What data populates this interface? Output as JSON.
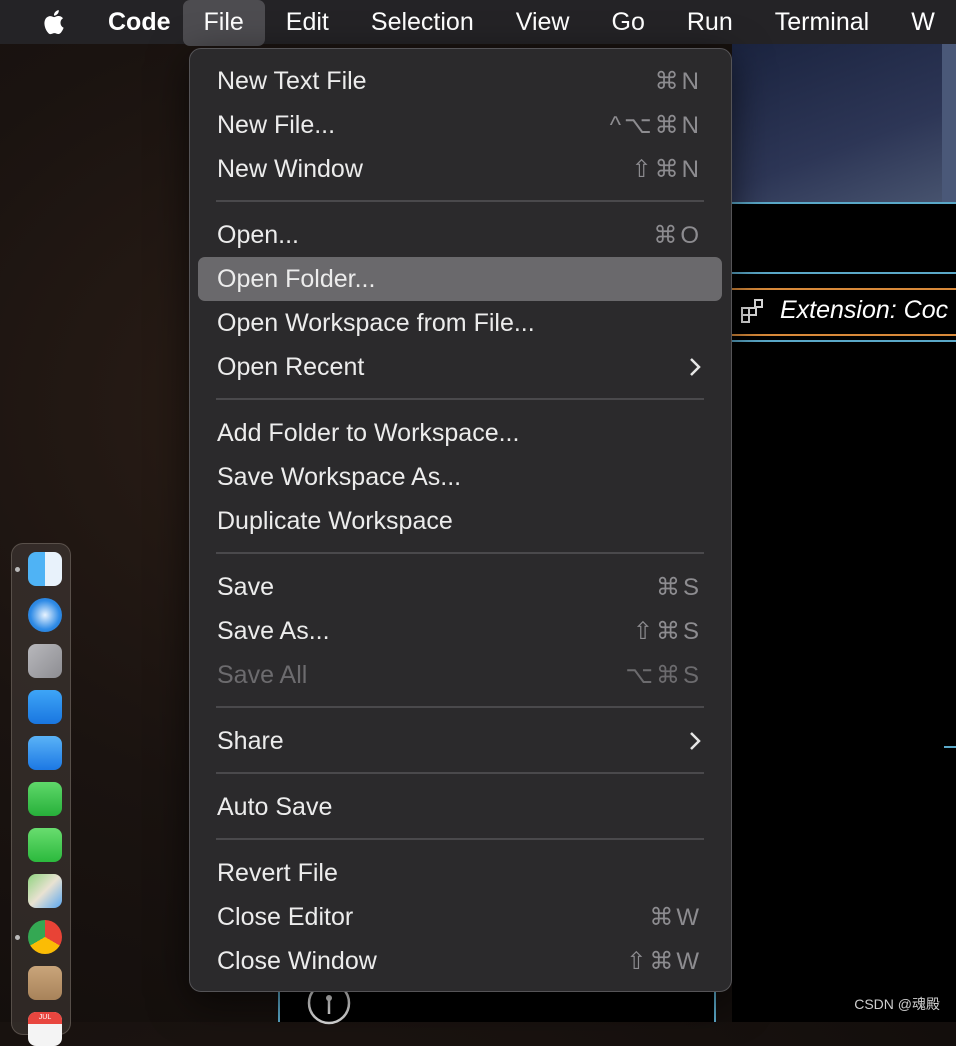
{
  "menubar": {
    "app_name": "Code",
    "items": [
      "File",
      "Edit",
      "Selection",
      "View",
      "Go",
      "Run",
      "Terminal",
      "W"
    ]
  },
  "vscode": {
    "extension_tab": "Extension: Coc"
  },
  "menu": {
    "items": [
      {
        "label": "New Text File",
        "shortcut": "⌘N"
      },
      {
        "label": "New File...",
        "shortcut": "^⌥⌘N"
      },
      {
        "label": "New Window",
        "shortcut": "⇧⌘N"
      },
      {
        "label": "Open...",
        "shortcut": "⌘O"
      },
      {
        "label": "Open Folder...",
        "shortcut": "",
        "highlighted": true
      },
      {
        "label": "Open Workspace from File...",
        "shortcut": ""
      },
      {
        "label": "Open Recent",
        "shortcut": "",
        "submenu": true
      },
      {
        "label": "Add Folder to Workspace...",
        "shortcut": ""
      },
      {
        "label": "Save Workspace As...",
        "shortcut": ""
      },
      {
        "label": "Duplicate Workspace",
        "shortcut": ""
      },
      {
        "label": "Save",
        "shortcut": "⌘S"
      },
      {
        "label": "Save As...",
        "shortcut": "⇧⌘S"
      },
      {
        "label": "Save All",
        "shortcut": "⌥⌘S",
        "disabled": true
      },
      {
        "label": "Share",
        "shortcut": "",
        "submenu": true
      },
      {
        "label": "Auto Save",
        "shortcut": ""
      },
      {
        "label": "Revert File",
        "shortcut": ""
      },
      {
        "label": "Close Editor",
        "shortcut": "⌘W"
      },
      {
        "label": "Close Window",
        "shortcut": "⇧⌘W"
      }
    ]
  },
  "dock": {
    "icons": [
      "finder-icon",
      "safari-icon",
      "launchpad-icon",
      "app-store-icon",
      "mail-icon",
      "facetime-icon",
      "messages-icon",
      "maps-icon",
      "chrome-icon",
      "contacts-icon",
      "calendar-icon"
    ],
    "calendar_month": "JUL"
  },
  "watermark": "CSDN @魂殿",
  "colors": {
    "menubar_bg": "#242326",
    "menu_bg": "#2b2a2c",
    "highlight": "#6a696c",
    "accent_line": "#5aa8c8",
    "orange_line": "#d98a3a"
  }
}
